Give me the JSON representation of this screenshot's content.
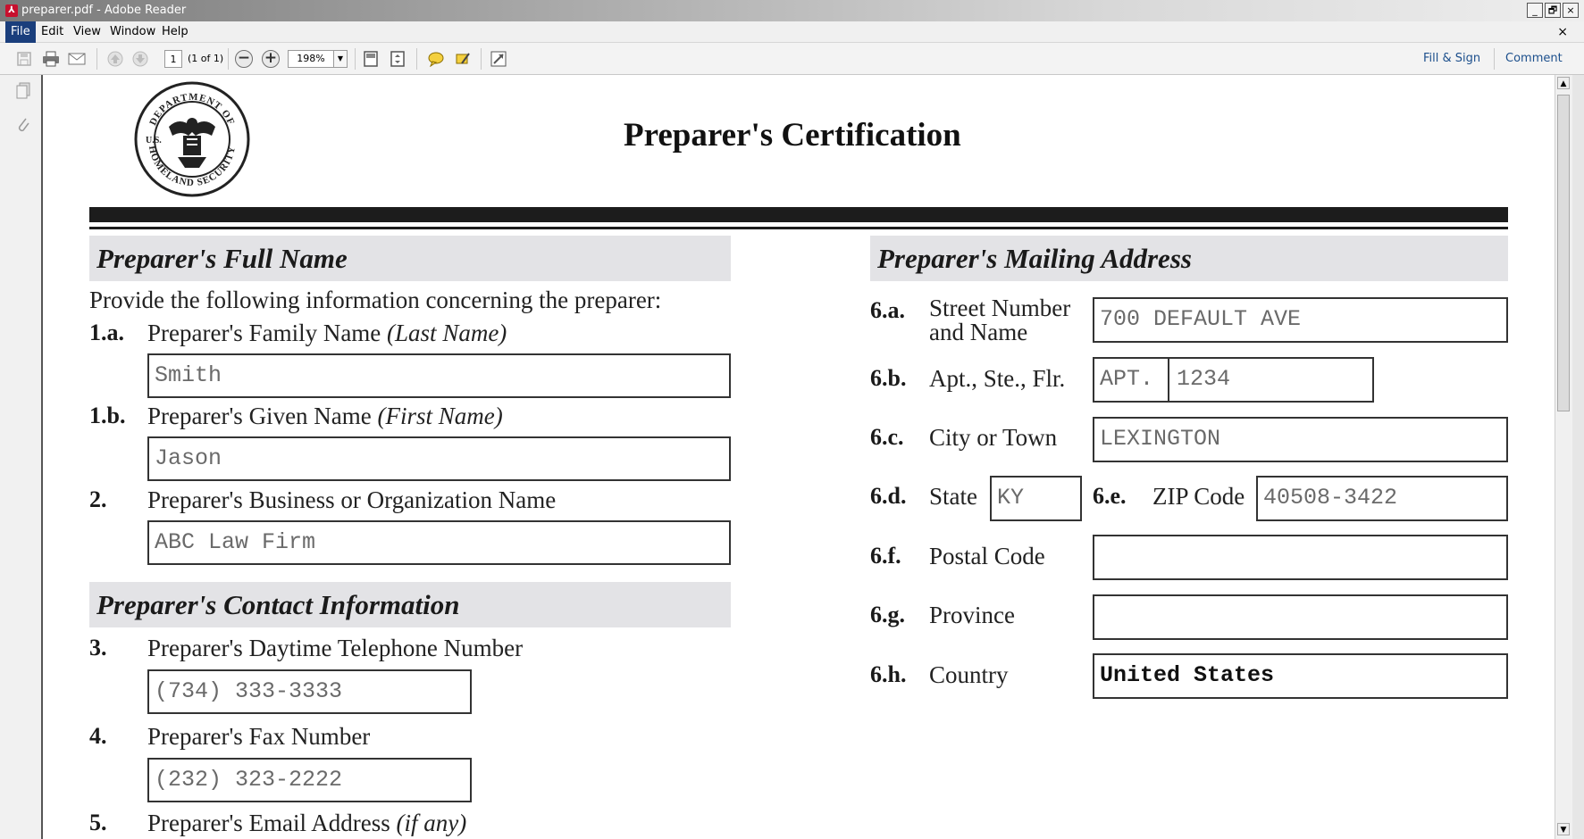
{
  "window": {
    "title": "preparer.pdf - Adobe Reader",
    "controls": {
      "minimize": "_",
      "restore": "🗗",
      "close": "×"
    }
  },
  "menu": {
    "items": [
      "File",
      "Edit",
      "View",
      "Window",
      "Help"
    ],
    "doc_close": "×"
  },
  "toolbar": {
    "page_number": "1",
    "page_count": "(1 of 1)",
    "zoom": "198%",
    "fill_sign": "Fill & Sign",
    "comment": "Comment"
  },
  "document": {
    "seal_text": "U.S. DEPARTMENT OF HOMELAND SECURITY",
    "title": "Preparer's Certification",
    "left": {
      "section_full_name": "Preparer's Full Name",
      "intro": "Provide the following information concerning the preparer:",
      "q1a": {
        "num": "1.a.",
        "label": "Preparer's Family Name",
        "hint": "(Last Name)",
        "value": "Smith"
      },
      "q1b": {
        "num": "1.b.",
        "label": "Preparer's Given Name",
        "hint": "(First Name)",
        "value": "Jason"
      },
      "q2": {
        "num": "2.",
        "label": "Preparer's Business or Organization Name",
        "value": "ABC Law Firm"
      },
      "section_contact": "Preparer's Contact Information",
      "q3": {
        "num": "3.",
        "label": "Preparer's Daytime Telephone Number",
        "value": "(734) 333-3333"
      },
      "q4": {
        "num": "4.",
        "label": "Preparer's Fax Number",
        "value": "(232) 323-2222"
      },
      "q5": {
        "num": "5.",
        "label": "Preparer's Email Address",
        "hint": "(if any)"
      }
    },
    "right": {
      "section_mailing": "Preparer's Mailing Address",
      "q6a": {
        "num": "6.a.",
        "label_line1": "Street Number",
        "label_line2": "and Name",
        "value": "700 DEFAULT AVE"
      },
      "q6b": {
        "num": "6.b.",
        "label": "Apt., Ste., Flr.",
        "type": "APT.",
        "value": "1234"
      },
      "q6c": {
        "num": "6.c.",
        "label": "City or Town",
        "value": "LEXINGTON"
      },
      "q6d": {
        "num": "6.d.",
        "label": "State",
        "value": "KY"
      },
      "q6e": {
        "num": "6.e.",
        "label": "ZIP Code",
        "value": "40508-3422"
      },
      "q6f": {
        "num": "6.f.",
        "label": "Postal Code",
        "value": ""
      },
      "q6g": {
        "num": "6.g.",
        "label": "Province",
        "value": ""
      },
      "q6h": {
        "num": "6.h.",
        "label": "Country",
        "value": "United States"
      }
    }
  }
}
